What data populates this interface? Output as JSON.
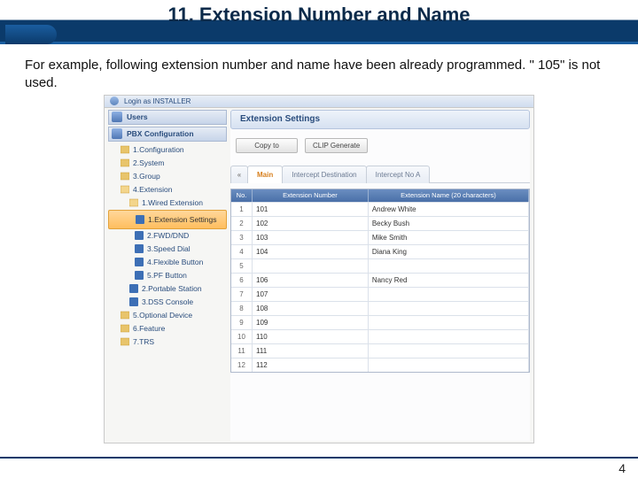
{
  "slide": {
    "title": "11. Extension Number and Name",
    "description": "For example, following extension number and name have been already programmed. \" 105\" is not used.",
    "page_number": "4"
  },
  "screenshot": {
    "login_text": "Login as INSTALLER",
    "sidebar": {
      "band_users": "Users",
      "band_config": "PBX Configuration",
      "items": [
        "1.Configuration",
        "2.System",
        "3.Group",
        "4.Extension"
      ],
      "ext_children": [
        "1.Wired Extension"
      ],
      "wired_children": [
        "1.Extension Settings",
        "2.FWD/DND",
        "3.Speed Dial",
        "4.Flexible Button",
        "5.PF Button"
      ],
      "tail": [
        "2.Portable Station",
        "3.DSS Console"
      ],
      "more": [
        "5.Optional Device",
        "6.Feature",
        "7.TRS"
      ]
    },
    "panel": {
      "title": "Extension Settings",
      "buttons": {
        "copy": "Copy to",
        "clip": "CLIP Generate"
      },
      "tabs": {
        "arrow": "«",
        "main": "Main",
        "intercept": "Intercept Destination",
        "intercept2": "Intercept No A"
      },
      "table": {
        "head_no": "No.",
        "head_ext": "Extension Number",
        "head_name": "Extension Name (20 characters)",
        "rows": [
          {
            "no": "1",
            "ext": "101",
            "name": "Andrew White"
          },
          {
            "no": "2",
            "ext": "102",
            "name": "Becky Bush"
          },
          {
            "no": "3",
            "ext": "103",
            "name": "Mike Smith"
          },
          {
            "no": "4",
            "ext": "104",
            "name": "Diana King"
          },
          {
            "no": "5",
            "ext": "",
            "name": ""
          },
          {
            "no": "6",
            "ext": "106",
            "name": "Nancy Red"
          },
          {
            "no": "7",
            "ext": "107",
            "name": ""
          },
          {
            "no": "8",
            "ext": "108",
            "name": ""
          },
          {
            "no": "9",
            "ext": "109",
            "name": ""
          },
          {
            "no": "10",
            "ext": "110",
            "name": ""
          },
          {
            "no": "11",
            "ext": "111",
            "name": ""
          },
          {
            "no": "12",
            "ext": "112",
            "name": ""
          }
        ]
      }
    }
  }
}
